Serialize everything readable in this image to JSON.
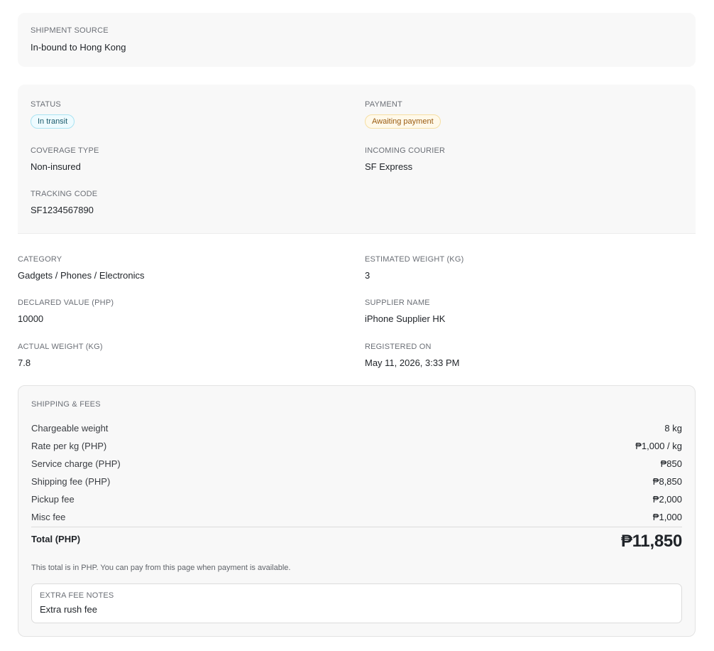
{
  "shipment_source": {
    "label": "SHIPMENT SOURCE",
    "value": "In-bound to Hong Kong"
  },
  "status_card": {
    "status": {
      "label": "STATUS",
      "value": "In transit"
    },
    "payment": {
      "label": "PAYMENT",
      "value": "Awaiting payment"
    },
    "coverage_type": {
      "label": "COVERAGE TYPE",
      "value": "Non-insured"
    },
    "incoming_courier": {
      "label": "INCOMING COURIER",
      "value": "SF Express"
    },
    "tracking_code": {
      "label": "TRACKING CODE",
      "value": "SF1234567890"
    }
  },
  "details": {
    "category": {
      "label": "CATEGORY",
      "value": "Gadgets / Phones / Electronics"
    },
    "estimated_weight": {
      "label": "ESTIMATED WEIGHT (KG)",
      "value": "3"
    },
    "declared_value": {
      "label": "DECLARED VALUE (PHP)",
      "value": "10000"
    },
    "supplier_name": {
      "label": "SUPPLIER NAME",
      "value": "iPhone Supplier HK"
    },
    "actual_weight": {
      "label": "ACTUAL WEIGHT (KG)",
      "value": "7.8"
    },
    "registered_on": {
      "label": "REGISTERED ON",
      "value": "May 11, 2026, 3:33 PM"
    }
  },
  "fees": {
    "title": "SHIPPING & FEES",
    "rows": [
      {
        "label": "Chargeable weight",
        "value": "8 kg"
      },
      {
        "label": "Rate per kg (PHP)",
        "value": "₱1,000 / kg"
      },
      {
        "label": "Service charge (PHP)",
        "value": "₱850"
      },
      {
        "label": "Shipping fee (PHP)",
        "value": "₱8,850"
      },
      {
        "label": "Pickup fee",
        "value": "₱2,000"
      },
      {
        "label": "Misc fee",
        "value": "₱1,000"
      }
    ],
    "total_label": "Total (PHP)",
    "total_value": "₱11,850",
    "note": "This total is in PHP. You can pay from this page when payment is available.",
    "extra_notes": {
      "label": "EXTRA FEE NOTES",
      "value": "Extra rush fee"
    }
  },
  "colors": {
    "card_bg": "#f8f8f8",
    "transit_pill": "#eefbff",
    "awaiting_pill": "#fff9ea"
  }
}
